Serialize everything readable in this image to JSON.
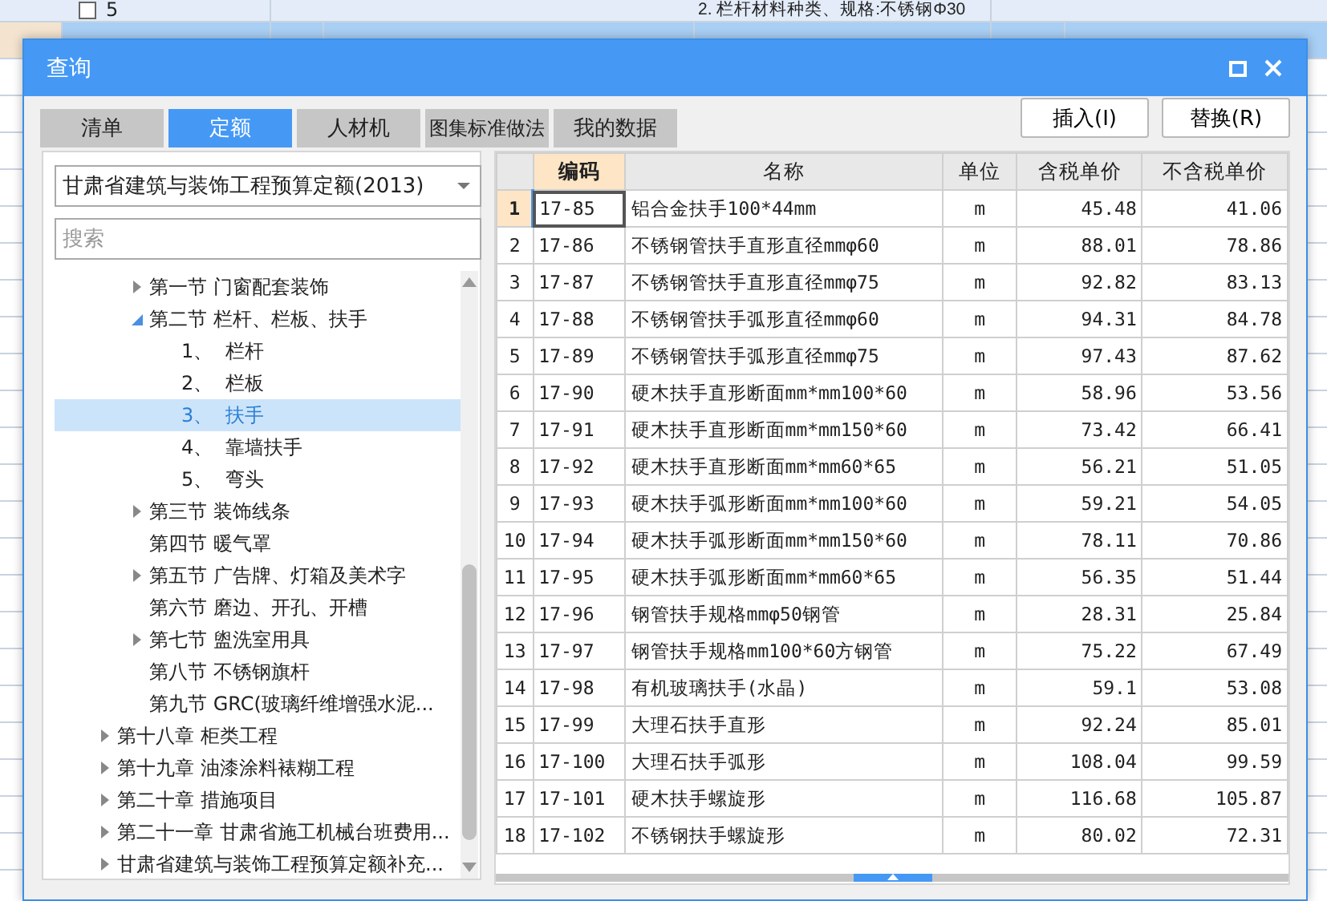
{
  "background_sheet": {
    "rows": [
      {
        "code": "5",
        "description": "2. 栏杆材料种类、规格:不锈钢Φ30",
        "selected": false
      },
      {
        "selected": true
      }
    ]
  },
  "window": {
    "title": "查询"
  },
  "tabs": [
    {
      "label": "清单",
      "selected": false
    },
    {
      "label": "定额",
      "selected": true
    },
    {
      "label": "人材机",
      "selected": false
    },
    {
      "label": "图集标准做法",
      "selected": false
    },
    {
      "label": "我的数据",
      "selected": false
    }
  ],
  "buttons": [
    "插入(I)",
    "替换(R)"
  ],
  "library_select": {
    "value": "甘肃省建筑与装饰工程预算定额(2013)"
  },
  "search": {
    "placeholder": "搜索"
  },
  "tree": [
    {
      "children": [
        {
          "label": "第一节 门窗配套装饰",
          "kind": "group",
          "expanded": false,
          "selected": false
        },
        {
          "label": "第二节 栏杆、栏板、扶手",
          "kind": "group",
          "expanded": true,
          "selected": false,
          "children": [
            {
              "label": "1、  栏杆",
              "kind": "leaf",
              "selected": false
            },
            {
              "label": "2、  栏板",
              "kind": "leaf",
              "selected": false
            },
            {
              "label": "3、  扶手",
              "kind": "leaf",
              "selected": true
            },
            {
              "label": "4、  靠墙扶手",
              "kind": "leaf",
              "selected": false
            },
            {
              "label": "5、  弯头",
              "kind": "leaf",
              "selected": false
            }
          ]
        },
        {
          "label": "第三节 装饰线条",
          "kind": "group",
          "expanded": false,
          "selected": false
        },
        {
          "label": "第四节 暖气罩",
          "kind": "leaf",
          "selected": false
        },
        {
          "label": "第五节 广告牌、灯箱及美术字",
          "kind": "group",
          "expanded": false,
          "selected": false
        },
        {
          "label": "第六节 磨边、开孔、开槽",
          "kind": "leaf",
          "selected": false
        },
        {
          "label": "第七节 盥洗室用具",
          "kind": "group",
          "expanded": false,
          "selected": false
        },
        {
          "label": "第八节 不锈钢旗杆",
          "kind": "leaf",
          "selected": false
        },
        {
          "label": "第九节 GRC(玻璃纤维增强水泥...",
          "kind": "leaf",
          "selected": false
        }
      ]
    },
    {
      "label": "第十八章 柜类工程",
      "kind": "group",
      "expanded": false,
      "selected": false
    },
    {
      "label": "第十九章 油漆涂料裱糊工程",
      "kind": "group",
      "expanded": false,
      "selected": false
    },
    {
      "label": "第二十章 措施项目",
      "kind": "group",
      "expanded": false,
      "selected": false
    },
    {
      "label": "第二十一章 甘肃省施工机械台班费用...",
      "kind": "group",
      "expanded": false,
      "selected": false
    },
    {
      "label": "甘肃省建筑与装饰工程预算定额补充...",
      "kind": "group",
      "expanded": false,
      "selected": false
    }
  ],
  "table": {
    "columns": [
      {
        "label": "编码",
        "selected": true
      },
      {
        "label": "名称",
        "selected": false
      },
      {
        "label": "单位",
        "selected": false
      },
      {
        "label": "含税单价",
        "selected": false
      },
      {
        "label": "不含税单价",
        "selected": false
      }
    ],
    "rows": [
      {
        "index": "1",
        "selected": true,
        "cells": [
          "17-85",
          "铝合金扶手100*44mm",
          "m",
          "45.48",
          "41.06"
        ]
      },
      {
        "index": "2",
        "selected": false,
        "cells": [
          "17-86",
          "不锈钢管扶手直形直径mmφ60",
          "m",
          "88.01",
          "78.86"
        ]
      },
      {
        "index": "3",
        "selected": false,
        "cells": [
          "17-87",
          "不锈钢管扶手直形直径mmφ75",
          "m",
          "92.82",
          "83.13"
        ]
      },
      {
        "index": "4",
        "selected": false,
        "cells": [
          "17-88",
          "不锈钢管扶手弧形直径mmφ60",
          "m",
          "94.31",
          "84.78"
        ]
      },
      {
        "index": "5",
        "selected": false,
        "cells": [
          "17-89",
          "不锈钢管扶手弧形直径mmφ75",
          "m",
          "97.43",
          "87.62"
        ]
      },
      {
        "index": "6",
        "selected": false,
        "cells": [
          "17-90",
          "硬木扶手直形断面mm*mm100*60",
          "m",
          "58.96",
          "53.56"
        ]
      },
      {
        "index": "7",
        "selected": false,
        "cells": [
          "17-91",
          "硬木扶手直形断面mm*mm150*60",
          "m",
          "73.42",
          "66.41"
        ]
      },
      {
        "index": "8",
        "selected": false,
        "cells": [
          "17-92",
          "硬木扶手直形断面mm*mm60*65",
          "m",
          "56.21",
          "51.05"
        ]
      },
      {
        "index": "9",
        "selected": false,
        "cells": [
          "17-93",
          "硬木扶手弧形断面mm*mm100*60",
          "m",
          "59.21",
          "54.05"
        ]
      },
      {
        "index": "10",
        "selected": false,
        "cells": [
          "17-94",
          "硬木扶手弧形断面mm*mm150*60",
          "m",
          "78.11",
          "70.86"
        ]
      },
      {
        "index": "11",
        "selected": false,
        "cells": [
          "17-95",
          "硬木扶手弧形断面mm*mm60*65",
          "m",
          "56.35",
          "51.44"
        ]
      },
      {
        "index": "12",
        "selected": false,
        "cells": [
          "17-96",
          "钢管扶手规格mmφ50钢管",
          "m",
          "28.31",
          "25.84"
        ]
      },
      {
        "index": "13",
        "selected": false,
        "cells": [
          "17-97",
          "钢管扶手规格mm100*60方钢管",
          "m",
          "75.22",
          "67.49"
        ]
      },
      {
        "index": "14",
        "selected": false,
        "cells": [
          "17-98",
          "有机玻璃扶手(水晶)",
          "m",
          "59.1",
          "53.08"
        ]
      },
      {
        "index": "15",
        "selected": false,
        "cells": [
          "17-99",
          "大理石扶手直形",
          "m",
          "92.24",
          "85.01"
        ]
      },
      {
        "index": "16",
        "selected": false,
        "cells": [
          "17-100",
          "大理石扶手弧形",
          "m",
          "108.04",
          "99.59"
        ]
      },
      {
        "index": "17",
        "selected": false,
        "cells": [
          "17-101",
          "硬木扶手螺旋形",
          "m",
          "116.68",
          "105.87"
        ]
      },
      {
        "index": "18",
        "selected": false,
        "cells": [
          "17-102",
          "不锈钢扶手螺旋形",
          "m",
          "80.02",
          "72.31"
        ]
      }
    ]
  }
}
